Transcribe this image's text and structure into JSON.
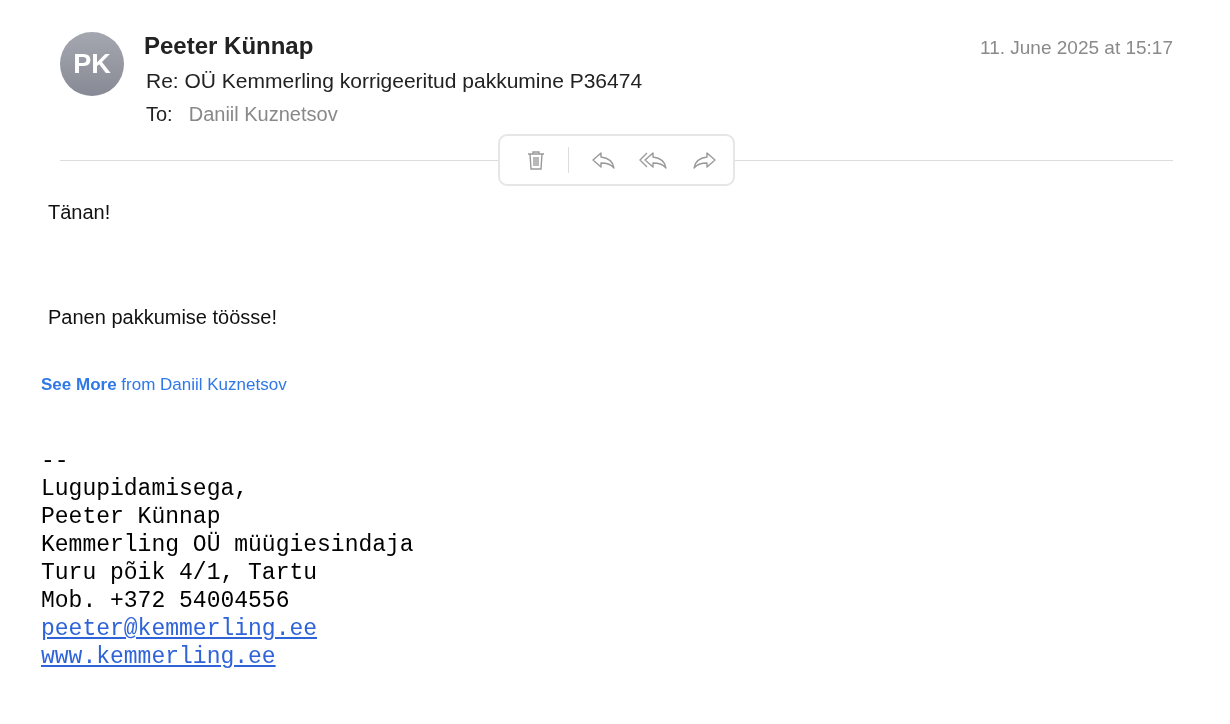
{
  "header": {
    "avatar_initials": "PK",
    "sender": "Peeter Künnap",
    "date": "11. June 2025 at 15:17",
    "subject": "Re: OÜ Kemmerling korrigeeritud pakkumine P36474",
    "to_label": "To:",
    "recipient": "Daniil Kuznetsov"
  },
  "body": {
    "paragraphs": [
      "Tänan!",
      "Panen pakkumise töösse!"
    ],
    "see_more": "**See More** from Daniil Kuznetsov"
  },
  "signature": [
    {
      "kind": "text",
      "text": "--"
    },
    {
      "kind": "text",
      "text": "Lugupidamisega,"
    },
    {
      "kind": "text",
      "text": "Peeter Künnap"
    },
    {
      "kind": "text",
      "text": "Kemmerling OÜ müügiesindaja"
    },
    {
      "kind": "text",
      "text": "Turu põik 4/1, Tartu"
    },
    {
      "kind": "text",
      "text": "Mob. +372 54004556"
    },
    {
      "kind": "link",
      "text": "peeter@kemmerling.ee"
    },
    {
      "kind": "link",
      "text": "www.kemmerling.ee"
    }
  ]
}
